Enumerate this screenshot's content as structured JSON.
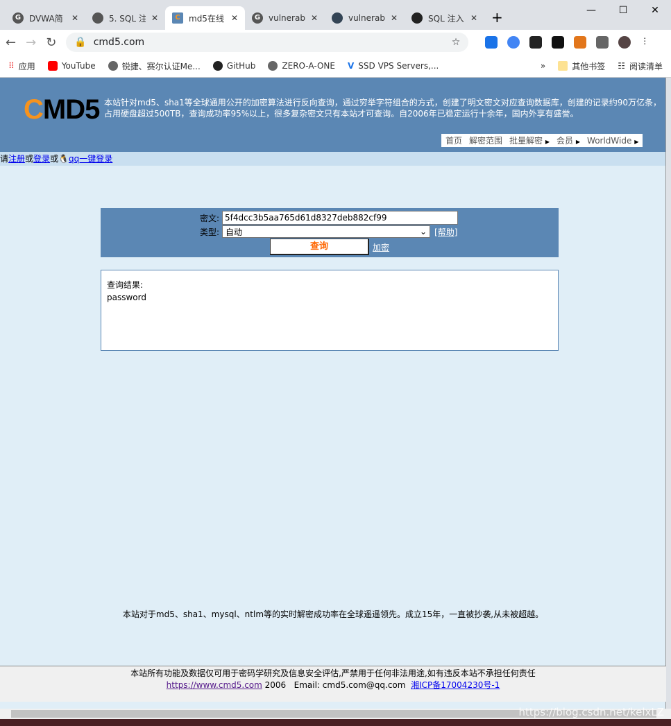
{
  "browser": {
    "tabs": [
      {
        "title": "DVWA简",
        "icon": "google-icon"
      },
      {
        "title": "5. SQL 注",
        "icon": "globe-icon"
      },
      {
        "title": "md5在线",
        "icon": "cmd5-icon",
        "active": true
      },
      {
        "title": "vulnerab",
        "icon": "google-icon"
      },
      {
        "title": "vulnerab",
        "icon": "docker-icon"
      },
      {
        "title": "SQL 注入",
        "icon": "github-icon"
      }
    ],
    "url": "cmd5.com",
    "bookmarks": [
      "应用",
      "YouTube",
      "锐捷、赛尔认证Me...",
      "GitHub",
      "ZERO-A-ONE",
      "SSD VPS Servers,..."
    ],
    "other_bookmarks": "其他书签",
    "reading_list": "阅读清单"
  },
  "site": {
    "logo": "CMD5",
    "intro": "本站针对md5、sha1等全球通用公开的加密算法进行反向查询，通过穷举字符组合的方式，创建了明文密文对应查询数据库，创建的记录约90万亿条，占用硬盘超过500TB，查询成功率95%以上，很多复杂密文只有本站才可查询。自2006年已稳定运行十余年，国内外享有盛誉。",
    "menu": [
      "首页",
      "解密范围",
      "批量解密",
      "会员",
      "WorldWide"
    ],
    "login": {
      "prefix": "请",
      "register": "注册",
      "or1": "或",
      "login": "登录",
      "or2": "或",
      "qq": "qq一键登录"
    },
    "form": {
      "cipher_label": "密文:",
      "cipher_value": "5f4dcc3b5aa765d61d8327deb882cf99",
      "type_label": "类型:",
      "type_value": "自动",
      "help": "[帮助]",
      "query": "查询",
      "encrypt": "加密"
    },
    "result": {
      "label": "查询结果:",
      "value": "password"
    },
    "slogan": "本站对于md5、sha1、mysql、ntlm等的实时解密成功率在全球遥遥领先。成立15年，一直被抄袭,从未被超越。",
    "footer": {
      "disclaimer": "本站所有功能及数据仅可用于密码学研究及信息安全评估,严禁用于任何非法用途,如有违反本站不承担任何责任",
      "url": "https://www.cmd5.com",
      "year": "2006",
      "email": "Email: cmd5.com@qq.com",
      "icp": "湘ICP备17004230号-1"
    }
  },
  "watermark": "https://blog.csdn.net/kelxLZ"
}
